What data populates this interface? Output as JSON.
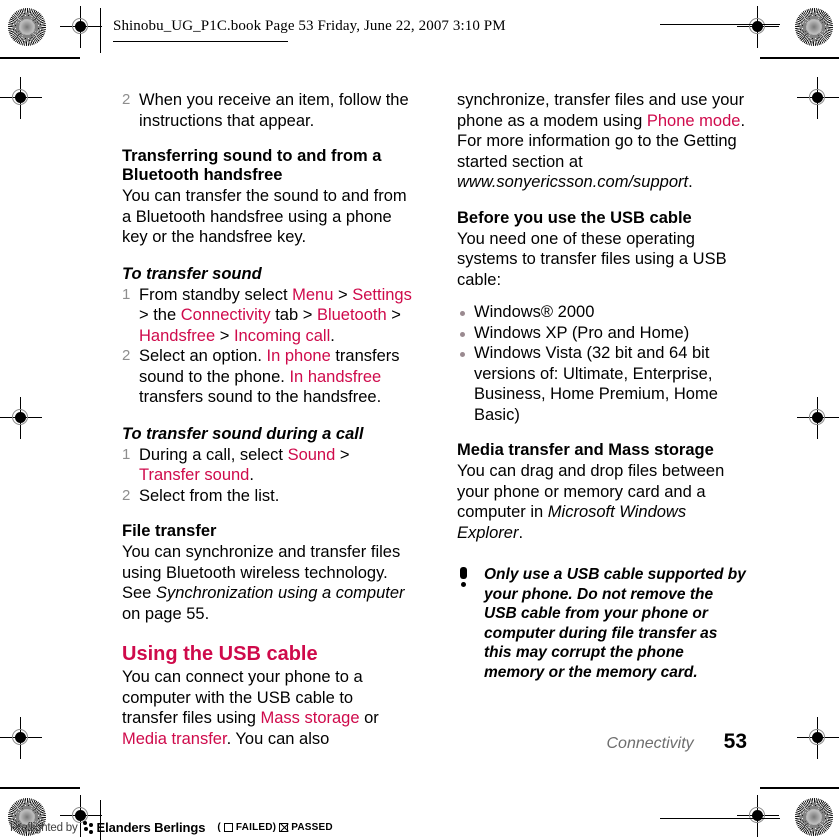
{
  "header": {
    "file_info": "Shinobu_UG_P1C.book  Page 53  Friday, June 22, 2007  3:10 PM"
  },
  "left_column": {
    "continued_step": {
      "number": "2",
      "text": "When you receive an item, follow the instructions that appear."
    },
    "bluetooth_heading": "Transferring sound to and from a Bluetooth handsfree",
    "bluetooth_body": "You can transfer the sound to and from a Bluetooth handsfree using a phone key or the handsfree key.",
    "proc1_title": "To transfer sound",
    "proc1_steps": [
      {
        "number": "1",
        "parts": [
          {
            "t": "From standby select ",
            "style": "plain"
          },
          {
            "t": "Menu",
            "style": "pink"
          },
          {
            "t": " > ",
            "style": "plain"
          },
          {
            "t": "Settings",
            "style": "pink"
          },
          {
            "t": " > the ",
            "style": "plain"
          },
          {
            "t": "Connectivity",
            "style": "pink"
          },
          {
            "t": " tab > ",
            "style": "plain"
          },
          {
            "t": "Bluetooth",
            "style": "pink"
          },
          {
            "t": " > ",
            "style": "plain"
          },
          {
            "t": "Handsfree",
            "style": "pink"
          },
          {
            "t": " > ",
            "style": "plain"
          },
          {
            "t": "Incoming call",
            "style": "pink"
          },
          {
            "t": ".",
            "style": "plain"
          }
        ]
      },
      {
        "number": "2",
        "parts": [
          {
            "t": "Select an option. ",
            "style": "plain"
          },
          {
            "t": "In phone",
            "style": "pink"
          },
          {
            "t": " transfers sound to the phone. ",
            "style": "plain"
          },
          {
            "t": "In handsfree",
            "style": "pink"
          },
          {
            "t": " transfers sound to the handsfree.",
            "style": "plain"
          }
        ]
      }
    ],
    "proc2_title": "To transfer sound during a call",
    "proc2_steps": [
      {
        "number": "1",
        "parts": [
          {
            "t": "During a call, select ",
            "style": "plain"
          },
          {
            "t": "Sound",
            "style": "pink"
          },
          {
            "t": " > ",
            "style": "plain"
          },
          {
            "t": "Transfer sound",
            "style": "pink"
          },
          {
            "t": ".",
            "style": "plain"
          }
        ]
      },
      {
        "number": "2",
        "parts": [
          {
            "t": "Select from the list.",
            "style": "plain"
          }
        ]
      }
    ],
    "file_transfer_heading": "File transfer",
    "file_transfer_parts": [
      {
        "t": "You can synchronize and transfer files using Bluetooth wireless technology. See ",
        "style": "plain"
      },
      {
        "t": "Synchronization using a computer",
        "style": "italic"
      },
      {
        "t": " on page 55.",
        "style": "plain"
      }
    ],
    "usb_heading": "Using the USB cable",
    "usb_body_parts": [
      {
        "t": "You can connect your phone to a computer with the USB cable to transfer files using ",
        "style": "plain"
      },
      {
        "t": "Mass storage",
        "style": "pink"
      },
      {
        "t": " or ",
        "style": "plain"
      },
      {
        "t": "Media transfer",
        "style": "pink"
      },
      {
        "t": ". You can also",
        "style": "plain"
      }
    ]
  },
  "right_column": {
    "continued_parts": [
      {
        "t": "synchronize, transfer files and use your phone as a modem using ",
        "style": "plain"
      },
      {
        "t": "Phone mode",
        "style": "pink"
      },
      {
        "t": ". For more information go to the Getting started section at ",
        "style": "plain"
      },
      {
        "t": "www.sonyericsson.com/support",
        "style": "italic"
      },
      {
        "t": ".",
        "style": "plain"
      }
    ],
    "before_heading": "Before you use the USB cable",
    "before_body": "You need one of these operating systems to transfer files using a USB cable:",
    "os_list": [
      "Windows® 2000",
      "Windows XP (Pro and Home)",
      "Windows Vista (32 bit and 64 bit versions of: Ultimate, Enterprise, Business, Home Premium, Home Basic)"
    ],
    "media_heading": "Media transfer and Mass storage",
    "media_body_parts": [
      {
        "t": "You can drag and drop files between your phone or memory card and a computer in ",
        "style": "plain"
      },
      {
        "t": "Microsoft Windows Explorer",
        "style": "italic"
      },
      {
        "t": ".",
        "style": "plain"
      }
    ],
    "note": "Only use a USB cable supported by your phone. Do not remove the USB cable from your phone or computer during file transfer as this may corrupt the phone memory or the memory card."
  },
  "footer": {
    "chapter": "Connectivity",
    "page_number": "53"
  },
  "preflight": {
    "label": "Preflighted by",
    "company": "Elanders Berlings",
    "open_paren": "(",
    "failed_label": "FAILED",
    "close_paren": ")",
    "passed_label": "PASSED"
  },
  "colors": {
    "accent_pink": "#cf0a4b",
    "body_black": "#000000",
    "muted_grey": "#6e6e6e"
  }
}
